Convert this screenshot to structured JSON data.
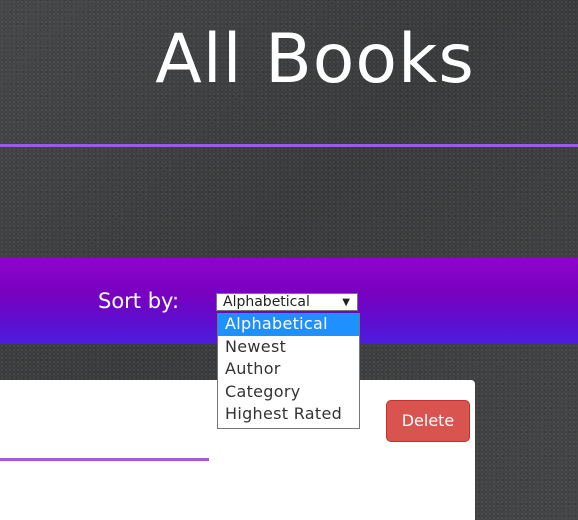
{
  "header": {
    "title": "All Books"
  },
  "sort": {
    "label": "Sort by:",
    "selected": "Alphabetical",
    "options": [
      "Alphabetical",
      "Newest",
      "Author",
      "Category",
      "Highest Rated"
    ],
    "highlighted_option": "Alphabetical"
  },
  "book_card": {
    "delete_label": "Delete"
  },
  "colors": {
    "accent_purple": "#a05ae0",
    "sort_bar_top": "#8d05cc",
    "sort_bar_bottom": "#4d1ee0",
    "delete_red": "#d9534f",
    "highlight_blue": "#1e90ff"
  }
}
